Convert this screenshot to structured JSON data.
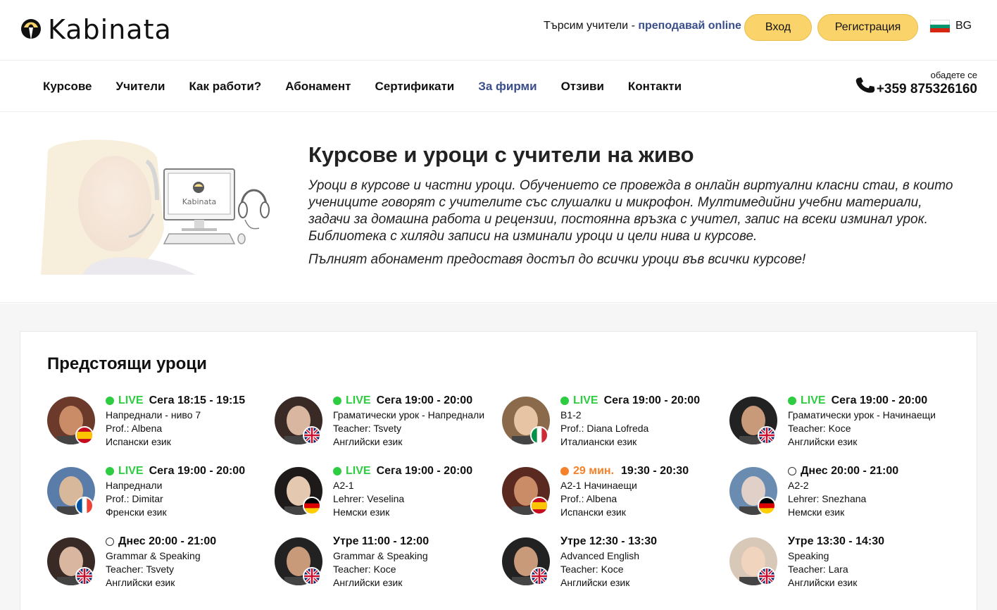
{
  "header": {
    "logo_text": "Kabinata",
    "recruit_text": "Търсим учители - ",
    "recruit_link": "преподавай online",
    "login_label": "Вход",
    "register_label": "Регистрация",
    "language": "BG"
  },
  "nav": {
    "items": [
      {
        "label": "Курсове"
      },
      {
        "label": "Учители"
      },
      {
        "label": "Как работи?"
      },
      {
        "label": "Абонамент"
      },
      {
        "label": "Сертификати"
      },
      {
        "label": "За фирми"
      },
      {
        "label": "Отзиви"
      },
      {
        "label": "Контакти"
      }
    ],
    "active_index": 5,
    "phone_label": "обадете се",
    "phone_number": "+359 875326160"
  },
  "hero": {
    "image_logo_text": "Kabinata",
    "title": "Курсове и уроци с учители на живо",
    "paragraph": "Уроци в курсове и частни уроци. Обучението се провежда в онлайн виртуални класни стаи, в които учениците говорят с учителите със слушалки и микрофон. Мултимедийни учебни материали, задачи за домашна работа и рецензии, постоянна връзка с учител, запис на всеки изминал урок. Библиотека с хиляди записи на изминали уроци и цели нива и курсове.",
    "paragraph2": "Пълният абонамент предоставя достъп до всички уроци във всички курсове!"
  },
  "lessons": {
    "title": "Предстоящи уроци",
    "items": [
      {
        "status": "live",
        "status_label": "LIVE",
        "time_prefix": "Сега",
        "time": "18:15 - 19:15",
        "level": "Напреднали - ниво 7",
        "teacher": "Prof.: Albena",
        "language": "Испански език",
        "flag": "es"
      },
      {
        "status": "live",
        "status_label": "LIVE",
        "time_prefix": "Сега",
        "time": "19:00 - 20:00",
        "level": "Граматически урок - Напреднали",
        "teacher": "Teacher: Tsvety",
        "language": "Английски език",
        "flag": "gb"
      },
      {
        "status": "live",
        "status_label": "LIVE",
        "time_prefix": "Сега",
        "time": "19:00 - 20:00",
        "level": "B1-2",
        "teacher": "Prof.: Diana Lofreda",
        "language": "Италиански език",
        "flag": "it"
      },
      {
        "status": "live",
        "status_label": "LIVE",
        "time_prefix": "Сега",
        "time": "19:00 - 20:00",
        "level": "Граматически урок - Начинаещи",
        "teacher": "Teacher: Koce",
        "language": "Английски език",
        "flag": "gb"
      },
      {
        "status": "live",
        "status_label": "LIVE",
        "time_prefix": "Сега",
        "time": "19:00 - 20:00",
        "level": "Напреднали",
        "teacher": "Prof.: Dimitar",
        "language": "Френски език",
        "flag": "fr"
      },
      {
        "status": "live",
        "status_label": "LIVE",
        "time_prefix": "Сега",
        "time": "19:00 - 20:00",
        "level": "A2-1",
        "teacher": "Lehrer: Veselina",
        "language": "Немски език",
        "flag": "de"
      },
      {
        "status": "soon",
        "status_label": "29 мин.",
        "time_prefix": "",
        "time": "19:30 - 20:30",
        "level": "A2-1 Начинаещи",
        "teacher": "Prof.: Albena",
        "language": "Испански език",
        "flag": "es"
      },
      {
        "status": "today",
        "status_label": "",
        "time_prefix": "Днес",
        "time": "20:00 - 21:00",
        "level": "A2-2",
        "teacher": "Lehrer: Snezhana",
        "language": "Немски език",
        "flag": "de"
      },
      {
        "status": "today",
        "status_label": "",
        "time_prefix": "Днес",
        "time": "20:00 - 21:00",
        "level": "Grammar & Speaking",
        "teacher": "Teacher: Tsvety",
        "language": "Английски език",
        "flag": "gb"
      },
      {
        "status": "tomorrow",
        "status_label": "",
        "time_prefix": "Утре",
        "time": "11:00 - 12:00",
        "level": "Grammar & Speaking",
        "teacher": "Teacher: Koce",
        "language": "Английски език",
        "flag": "gb"
      },
      {
        "status": "tomorrow",
        "status_label": "",
        "time_prefix": "Утре",
        "time": "12:30 - 13:30",
        "level": "Advanced English",
        "teacher": "Teacher: Koce",
        "language": "Английски език",
        "flag": "gb"
      },
      {
        "status": "tomorrow",
        "status_label": "",
        "time_prefix": "Утре",
        "time": "13:30 - 14:30",
        "level": "Speaking",
        "teacher": "Teacher: Lara",
        "language": "Английски език",
        "flag": "gb"
      }
    ]
  },
  "colors": {
    "accent_blue": "#3a4e8c",
    "button_yellow": "#fad46a",
    "live_green": "#2ecc40",
    "soon_orange": "#f5822a"
  }
}
